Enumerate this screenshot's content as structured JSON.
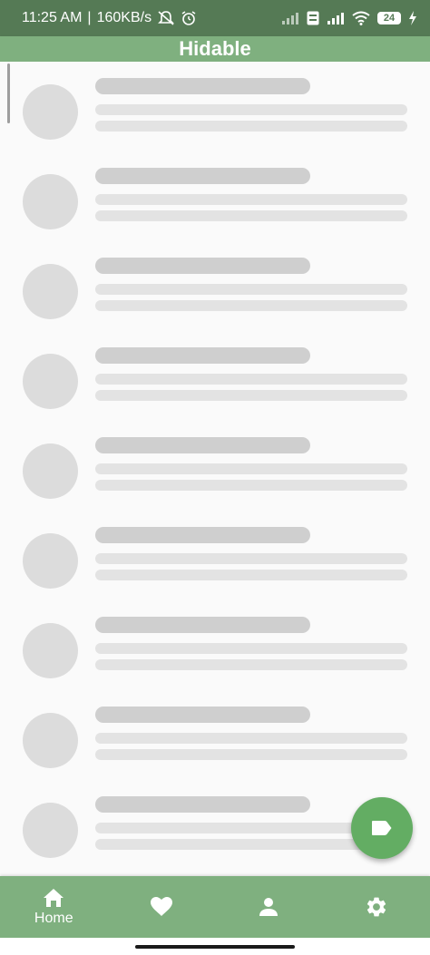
{
  "status_bar": {
    "time": "11:25 AM",
    "separator": "|",
    "network_speed": "160KB/s",
    "battery_level": "24",
    "icons": [
      "mute-notification-icon",
      "alarm-icon",
      "signal-icon",
      "volte-icon",
      "signal-icon",
      "wifi-icon",
      "battery-icon",
      "charging-icon"
    ]
  },
  "app_bar": {
    "title": "Hidable"
  },
  "list": {
    "placeholder_items": 9
  },
  "fab": {
    "icon": "label-icon"
  },
  "bottom_nav": {
    "items": [
      {
        "label": "Home",
        "icon": "home-icon",
        "selected": true
      },
      {
        "label": "",
        "icon": "heart-icon",
        "selected": false
      },
      {
        "label": "",
        "icon": "person-icon",
        "selected": false
      },
      {
        "label": "",
        "icon": "gear-icon",
        "selected": false
      }
    ]
  },
  "colors": {
    "status_bar": "#557a55",
    "app_bar": "#7fb07f",
    "fab": "#63ad63",
    "skeleton_dark": "#cfcfcf",
    "skeleton_light": "#e3e3e3",
    "avatar": "#dcdcdc"
  }
}
